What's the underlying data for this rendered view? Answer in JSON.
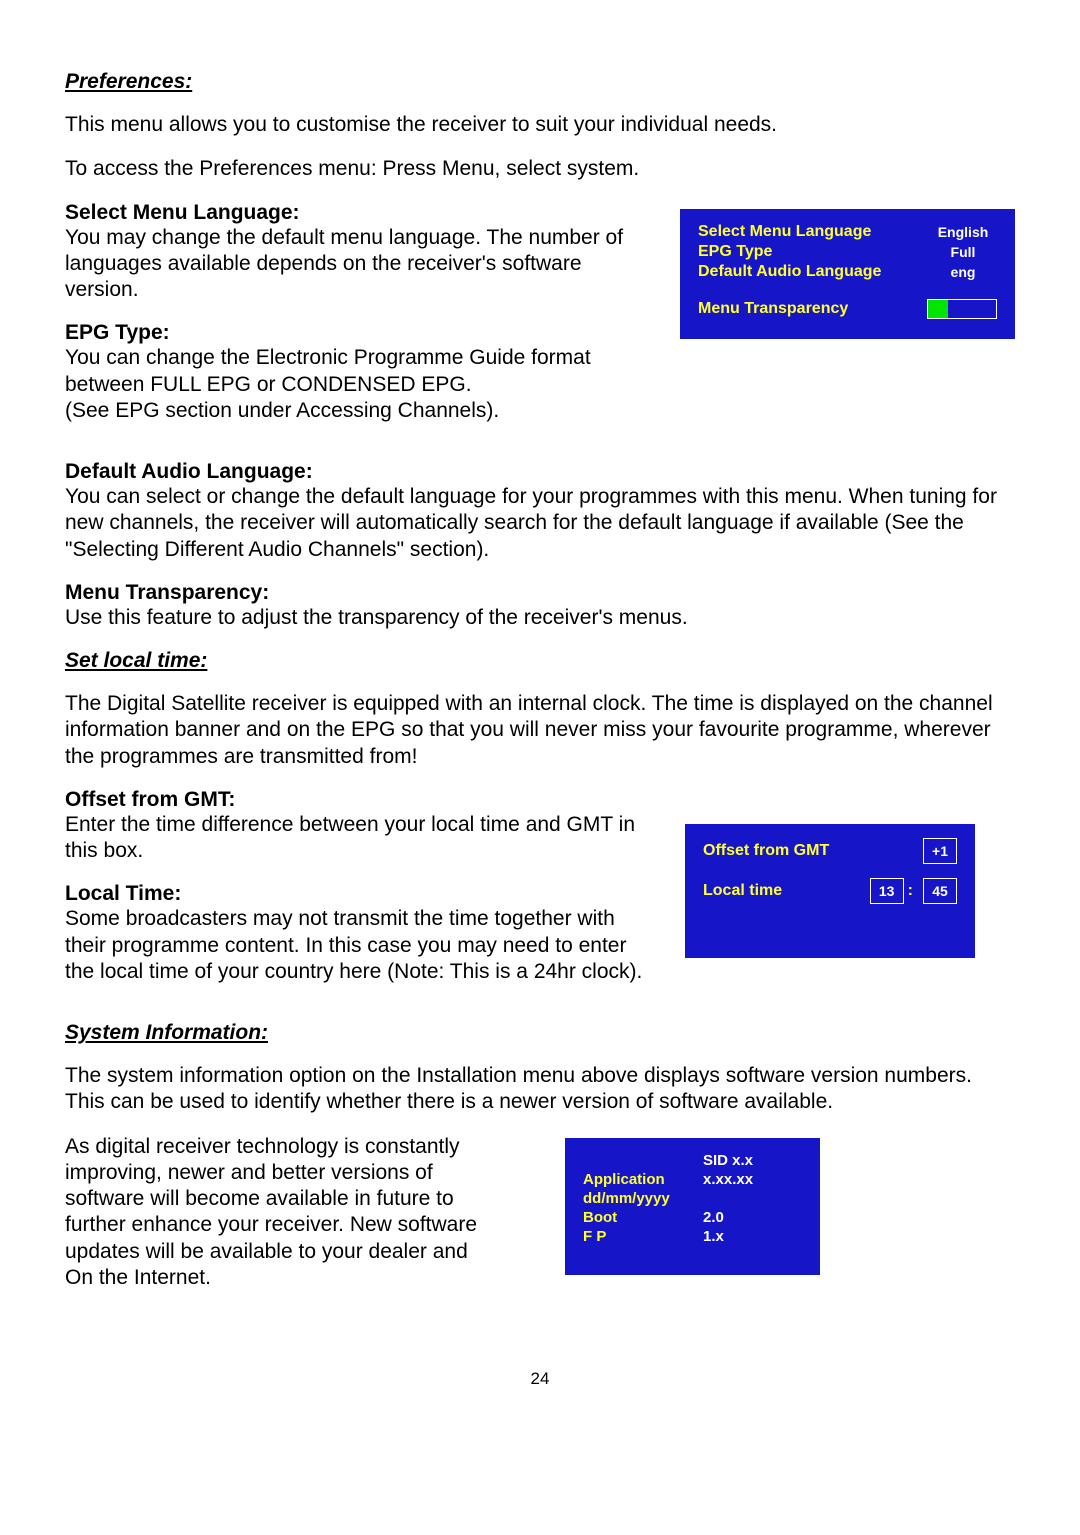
{
  "preferences": {
    "title": "Preferences:",
    "intro": "This menu allows you to customise the receiver to suit your individual needs.",
    "access": "To access the Preferences menu: Press Menu, select system.",
    "selectMenuLanguage": {
      "heading": "Select Menu Language:",
      "body": "You may change the default menu language. The number of languages available depends on the receiver's software version."
    },
    "epgType": {
      "heading": "EPG Type:",
      "body1": "You can change the Electronic Programme Guide format between FULL EPG or CONDENSED EPG.",
      "body2": "(See EPG section under Accessing Channels)."
    },
    "defaultAudio": {
      "heading": "Default Audio Language:",
      "body": "You can select or change the default language for your programmes with this menu. When tuning for new channels, the receiver will automatically search for the default language if available (See the \"Selecting Different Audio Channels\" section)."
    },
    "menuTransparency": {
      "heading": "Menu Transparency:",
      "body": "Use this feature to adjust the transparency of the receiver's menus."
    },
    "osd": {
      "row1Label": "Select Menu Language",
      "row1Val": "English",
      "row2Label": "EPG Type",
      "row2Val": "Full",
      "row3Label": "Default Audio Language",
      "row3Val": "eng",
      "row4Label": "Menu Transparency"
    }
  },
  "setLocalTime": {
    "title": "Set local time:",
    "intro": "The Digital Satellite receiver is equipped with an internal clock. The time is displayed on the channel information banner and on the EPG so that you will never miss your favourite programme, wherever the programmes are transmitted from!",
    "offset": {
      "heading": "Offset from GMT:",
      "body": "Enter the time difference between your local time and GMT in this box."
    },
    "localTime": {
      "heading": "Local Time:",
      "body": "Some broadcasters may not transmit the time together with their programme content. In this case you may need to enter the local time of your country here (Note: This is a 24hr clock)."
    },
    "osd": {
      "offsetLabel": "Offset from GMT",
      "offsetVal": "+1",
      "localLabel": "Local time",
      "hour": "13",
      "minute": "45"
    }
  },
  "systemInfo": {
    "title": "System Information:",
    "intro": "The system information option on the Installation menu above displays software version numbers. This can be used to identify whether there is a newer version of software available.",
    "body": "As digital receiver technology is constantly improving, newer and better versions of software will become available in future to further enhance your receiver. New software updates will be available to your dealer and On the Internet.",
    "osd": {
      "sid": "SID x.x",
      "appLabel": "Application",
      "appVal": "x.xx.xx",
      "dateLabel": "dd/mm/yyyy",
      "bootLabel": "Boot",
      "bootVal": "2.0",
      "fpLabel": "F P",
      "fpVal": "1.x"
    }
  },
  "pageNumber": "24"
}
